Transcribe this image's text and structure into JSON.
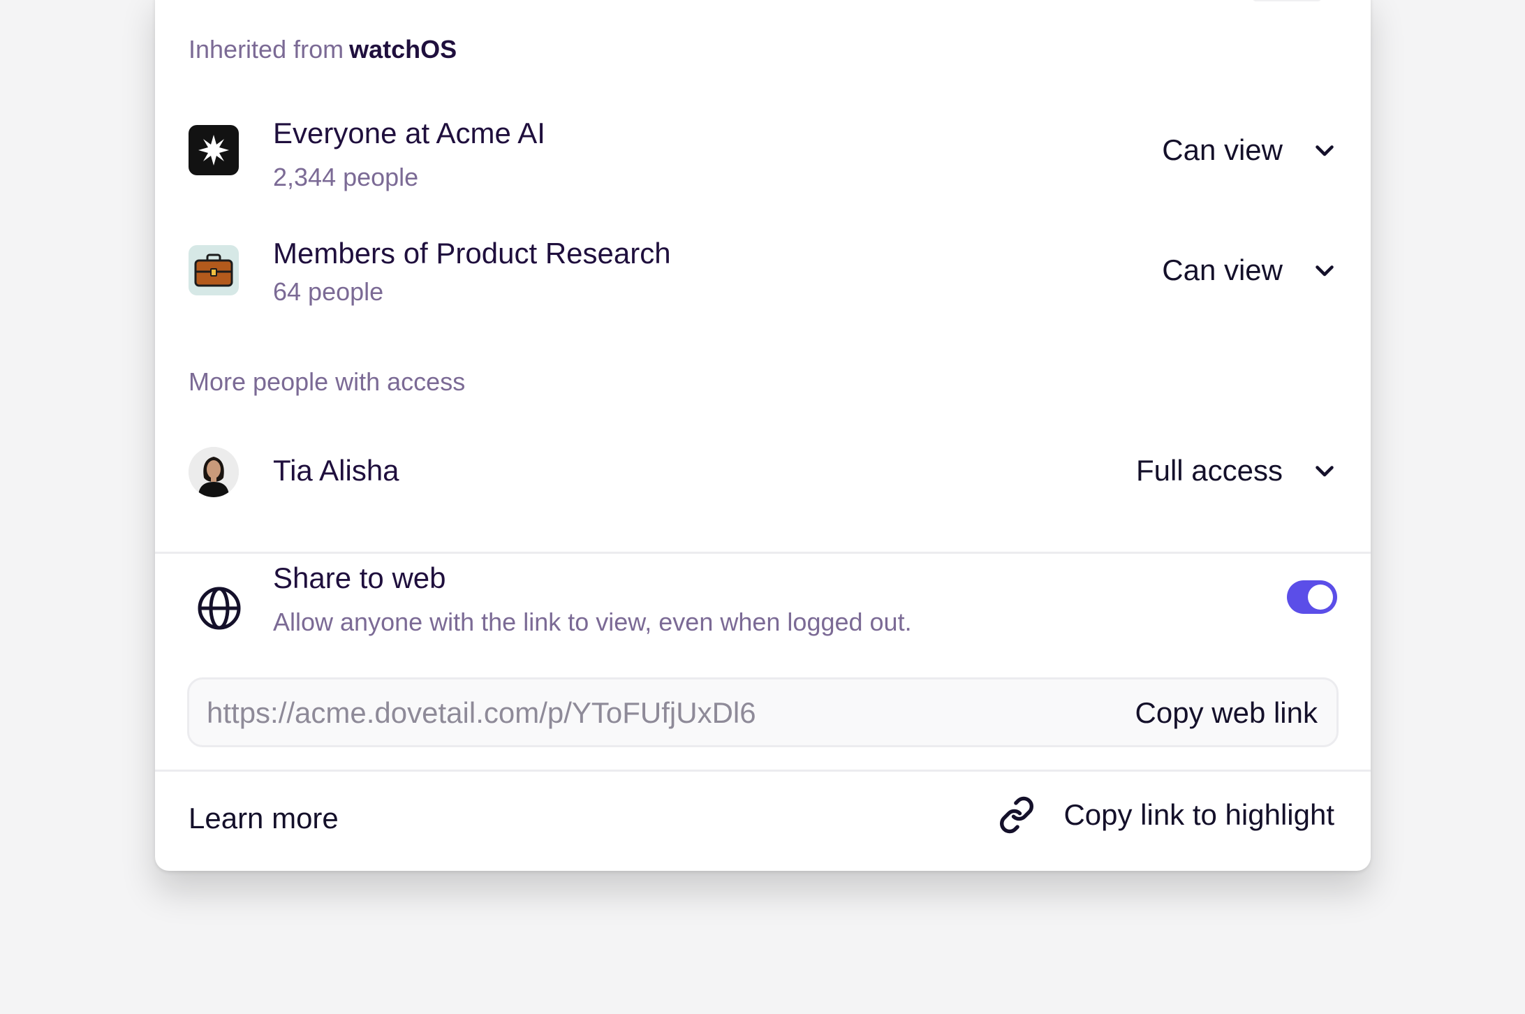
{
  "inherited": {
    "prefix": "Inherited from",
    "source": "watchOS"
  },
  "groups": [
    {
      "name": "Everyone at Acme AI",
      "count": "2,344 people",
      "permission": "Can view",
      "icon": "acme-logo-icon"
    },
    {
      "name": "Members of Product Research",
      "count": "64 people",
      "permission": "Can view",
      "icon": "briefcase-icon"
    }
  ],
  "more_people": {
    "heading": "More people with access",
    "people": [
      {
        "name": "Tia Alisha",
        "permission": "Full access",
        "icon": "avatar"
      }
    ]
  },
  "share_web": {
    "title": "Share to web",
    "description": "Allow anyone with the link to view, even when logged out.",
    "enabled": true,
    "url": "https://acme.dovetail.com/p/YToFUfjUxDl6",
    "copy_label": "Copy web link",
    "icon": "globe-icon"
  },
  "footer": {
    "learn_more": "Learn more",
    "copy_highlight": "Copy link to highlight",
    "icon": "link-icon"
  },
  "colors": {
    "accent": "#5b4ee8",
    "text_primary": "#1f0f3d",
    "text_secondary": "#7b6a95"
  }
}
